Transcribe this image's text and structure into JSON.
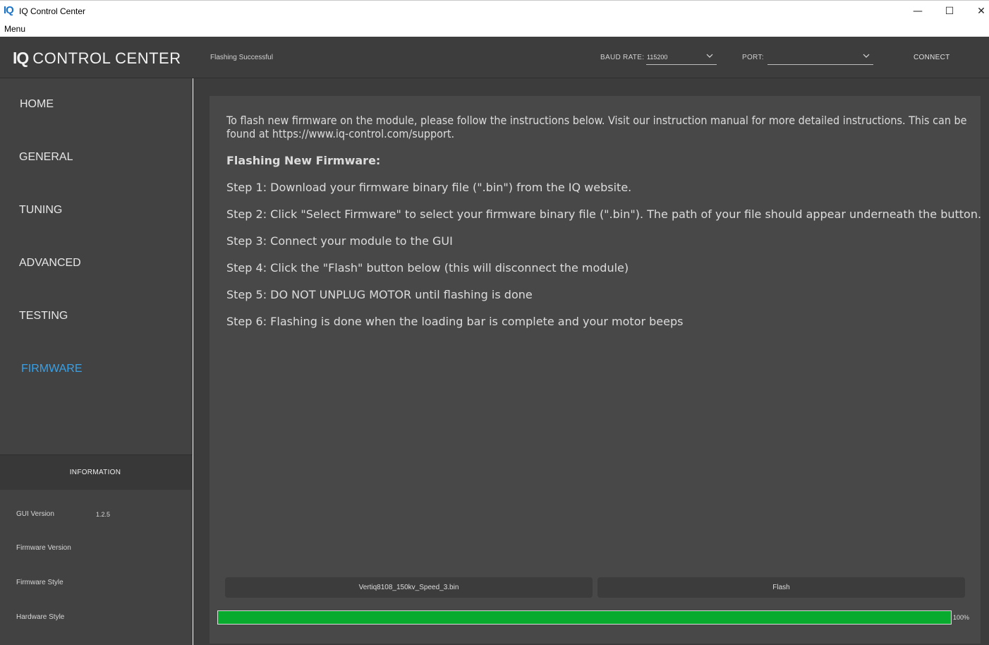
{
  "window": {
    "logo_text": "IQ",
    "title": "IQ Control Center",
    "minimize_glyph": "—",
    "maximize_glyph": "☐",
    "close_glyph": "✕"
  },
  "menubar": {
    "menu_label": "Menu"
  },
  "header": {
    "brand_iq": "IQ",
    "brand_text": "CONTROL CENTER",
    "status": "Flashing Successful",
    "baud_label": "BAUD RATE:",
    "baud_value": "115200",
    "port_label": "PORT:",
    "port_value": "",
    "connect_label": "CONNECT"
  },
  "sidebar": {
    "items": [
      {
        "label": "HOME"
      },
      {
        "label": "GENERAL"
      },
      {
        "label": "TUNING"
      },
      {
        "label": "ADVANCED"
      },
      {
        "label": "TESTING"
      },
      {
        "label": "FIRMWARE",
        "active": true
      }
    ],
    "info_title": "INFORMATION",
    "info_rows": [
      {
        "label": "GUI Version",
        "value": "1.2.5"
      },
      {
        "label": "Firmware Version",
        "value": ""
      },
      {
        "label": "Firmware Style",
        "value": ""
      },
      {
        "label": "Hardware Style",
        "value": ""
      }
    ]
  },
  "main": {
    "intro": "To flash new firmware on the module, please follow the instructions below. Visit our instruction manual for more detailed instructions. This can be found at https://www.iq-control.com/support.",
    "heading": "Flashing New Firmware:",
    "steps": [
      "Step 1: Download your firmware binary file (\".bin\") from the IQ website.",
      "Step 2: Click \"Select Firmware\" to select your firmware binary file (\".bin\"). The path of your file should appear underneath the button.",
      "Step 3: Connect your module to the GUI",
      "Step 4: Click the \"Flash\" button below (this will disconnect the module)",
      "Step 5: DO NOT UNPLUG MOTOR until flashing is done",
      "Step 6: Flashing is done when the loading bar is complete and your motor beeps"
    ],
    "file_button_label": "Vertiq8108_150kv_Speed_3.bin",
    "flash_button_label": "Flash",
    "progress_fraction": 1.0,
    "progress_text": "100%"
  },
  "colors": {
    "accent": "#39a0e6",
    "progress": "#08ab2d",
    "header_bg": "#3d3d3d",
    "sidebar_bg": "#424242",
    "panel_bg": "#484848"
  },
  "icons": {
    "dropdown": "chevron-down-icon"
  }
}
